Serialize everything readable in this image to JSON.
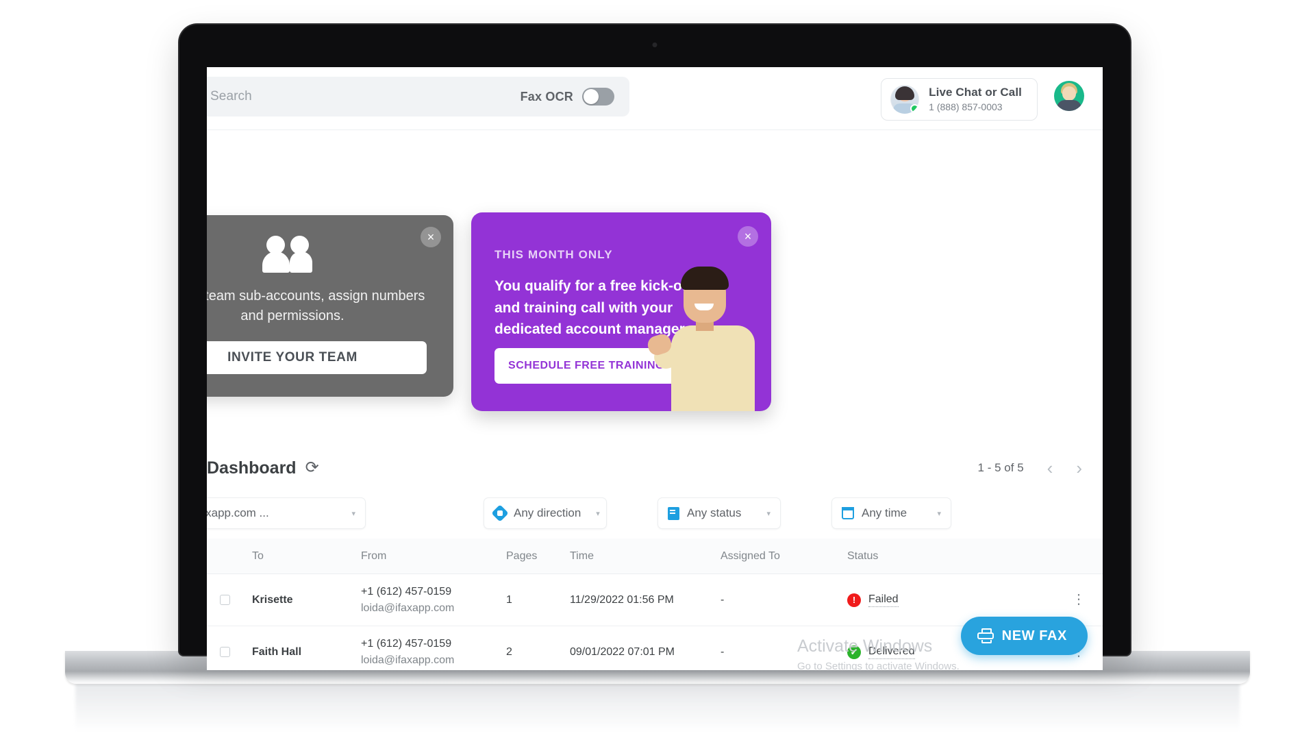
{
  "header": {
    "search_placeholder": "Search",
    "ocr_label": "Fax OCR",
    "ocr_state": "off",
    "live_chat_title": "Live Chat or Call",
    "live_chat_phone": "1 (888) 857-0003"
  },
  "cards": {
    "team": {
      "body": "Create team sub-accounts, assign numbers and permissions.",
      "button": "INVITE YOUR TEAM",
      "close": "×",
      "bg": "#6b6b6b"
    },
    "promo": {
      "kicker": "THIS MONTH ONLY",
      "headline": "You qualify for a free kick-off and training call with your dedicated account manager.",
      "button": "SCHEDULE FREE TRAINING",
      "close": "×",
      "bg": "#9333d6"
    }
  },
  "dashboard": {
    "title": "Dashboard",
    "refresh_icon": "⟳",
    "pagination": "1 - 5 of 5",
    "prev_arrow": "‹",
    "next_arrow": "›"
  },
  "filters": [
    {
      "label": "loida@ifaxapp.com ...",
      "icon": "none",
      "caret": "▾"
    },
    {
      "label": "Any direction",
      "icon": "direction-icon",
      "caret": "▾"
    },
    {
      "label": "Any status",
      "icon": "status-doc-icon",
      "caret": "▾"
    },
    {
      "label": "Any time",
      "icon": "calendar-icon",
      "caret": "▾"
    }
  ],
  "table": {
    "columns": [
      "To",
      "From",
      "Pages",
      "Time",
      "Assigned To",
      "Status"
    ],
    "rows": [
      {
        "to": "Krisette",
        "from_phone": "+1 (612) 457-0159",
        "from_email": "loida@ifaxapp.com",
        "pages": "1",
        "time": "11/29/2022 01:56 PM",
        "assigned_to": "-",
        "status": "Failed",
        "status_color": "#f01b1b",
        "status_glyph": "!",
        "menu": "⋮"
      },
      {
        "to": "Faith Hall",
        "from_phone": "+1 (612) 457-0159",
        "from_email": "loida@ifaxapp.com",
        "pages": "2",
        "time": "09/01/2022 07:01 PM",
        "assigned_to": "-",
        "status": "Delivered",
        "status_color": "#2bb32b",
        "status_glyph": "✓",
        "menu": "⋮"
      }
    ]
  },
  "watermark": {
    "line1": "Activate Windows",
    "line2": "Go to Settings to activate Windows."
  },
  "fab": {
    "label": "NEW FAX",
    "color": "#29a3de"
  }
}
